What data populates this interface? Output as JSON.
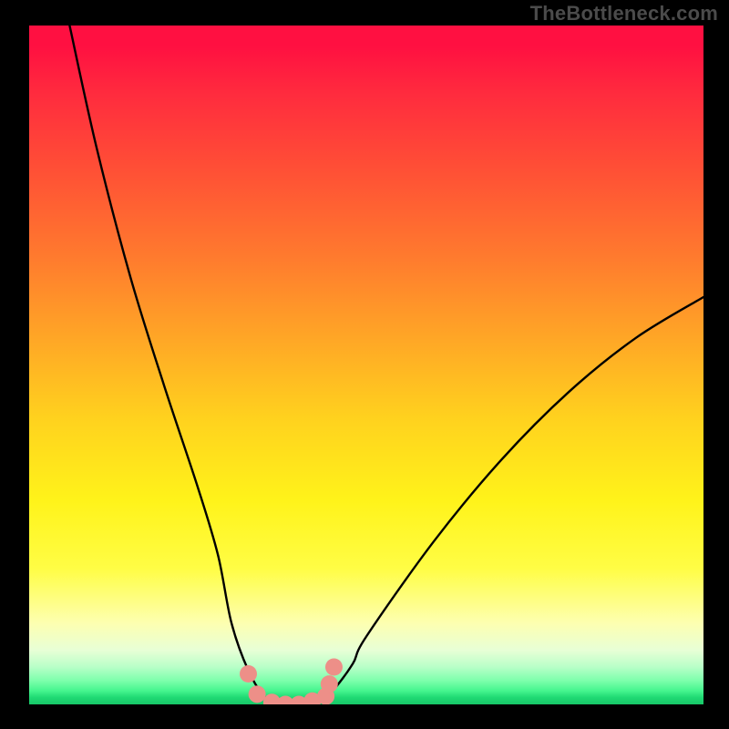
{
  "watermark": "TheBottleneck.com",
  "chart_data": {
    "type": "line",
    "title": "",
    "xlabel": "",
    "ylabel": "",
    "xlim": [
      0,
      100
    ],
    "ylim": [
      0,
      100
    ],
    "grid": false,
    "legend": false,
    "background_gradient": [
      "#ff1041",
      "#ff2b3e",
      "#ff5235",
      "#ff7a2e",
      "#ffa626",
      "#ffd21e",
      "#fff31a",
      "#fffd45",
      "#fdffb0",
      "#e8ffd6",
      "#b8ffc8",
      "#7dffab",
      "#45f58e",
      "#1fd973",
      "#18c768"
    ],
    "series": [
      {
        "name": "bottleneck-curve",
        "color": "#000000",
        "x": [
          6,
          10,
          15,
          20,
          25,
          28,
          30,
          32.5,
          35,
          37,
          39,
          41,
          43,
          45,
          48,
          50,
          60,
          70,
          80,
          90,
          100
        ],
        "y": [
          100,
          82,
          63,
          47,
          32,
          22,
          12,
          5,
          1,
          0,
          0,
          0,
          0.5,
          2,
          6,
          10,
          24,
          36,
          46,
          54,
          60
        ]
      }
    ],
    "markers": [
      {
        "name": "bottom-dots",
        "color": "#ed8f88",
        "points": [
          {
            "x": 32.5,
            "y": 4.5
          },
          {
            "x": 33.8,
            "y": 1.5
          },
          {
            "x": 36.0,
            "y": 0.3
          },
          {
            "x": 38.0,
            "y": 0.0
          },
          {
            "x": 40.0,
            "y": 0.0
          },
          {
            "x": 42.0,
            "y": 0.5
          },
          {
            "x": 44.0,
            "y": 1.2
          },
          {
            "x": 44.5,
            "y": 3.0
          },
          {
            "x": 45.2,
            "y": 5.5
          }
        ]
      }
    ]
  }
}
